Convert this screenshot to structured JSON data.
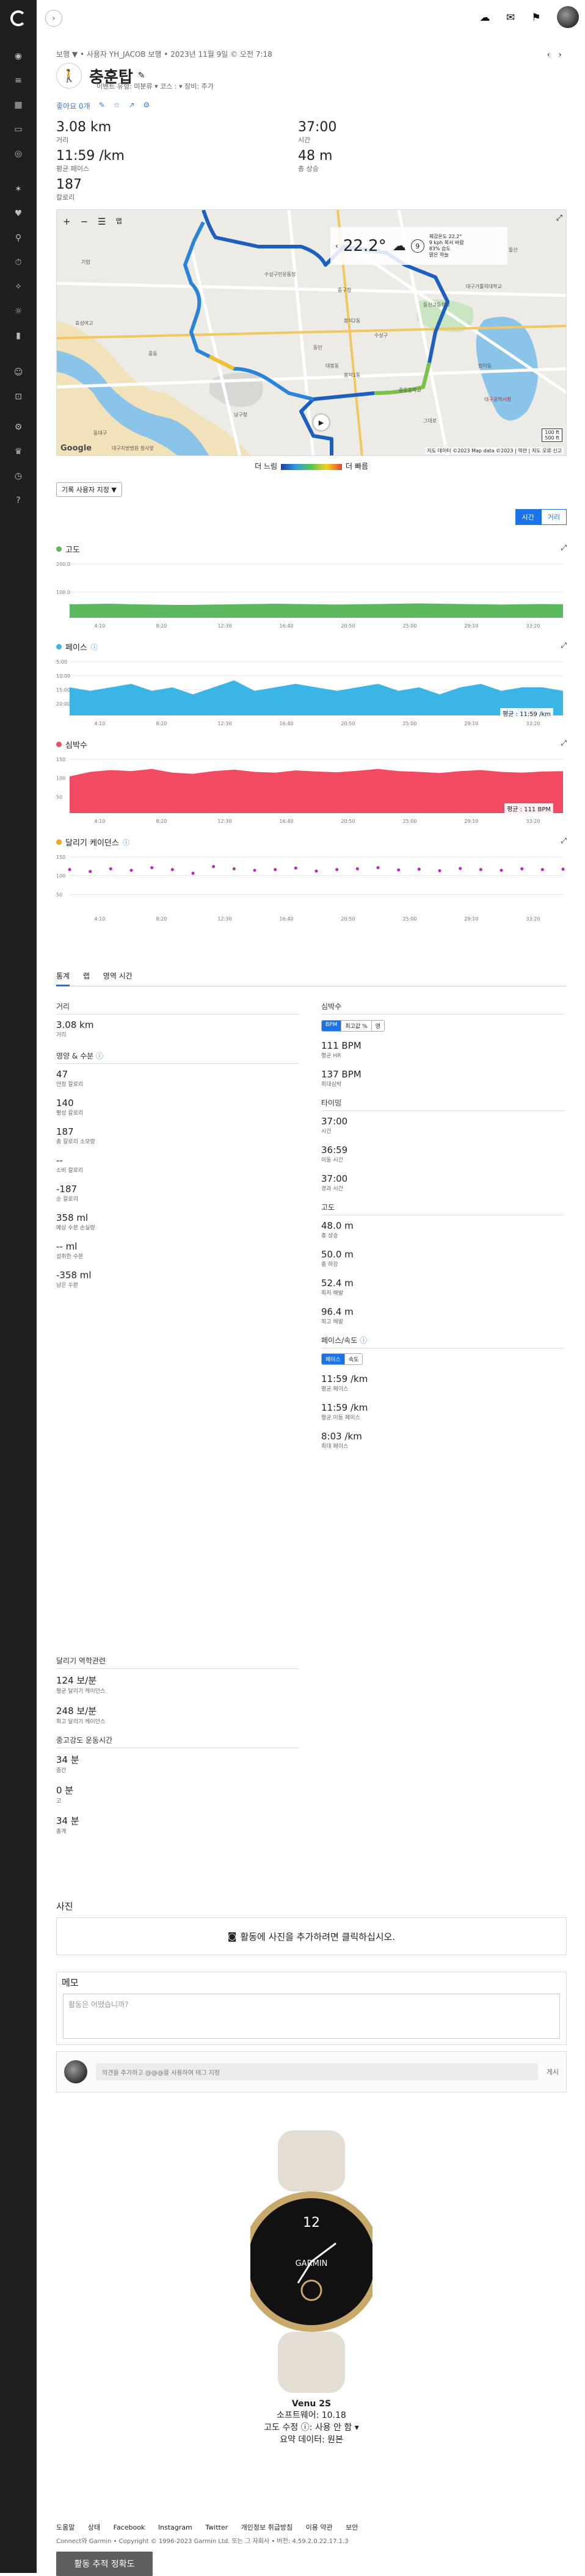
{
  "app": {
    "title": "Garmin Connect"
  },
  "sidebar": {
    "items": [
      "dashboard",
      "calendar",
      "training",
      "reports",
      "running",
      "health",
      "performance",
      "settings",
      "devices",
      "badges",
      "challenges",
      "groups",
      "connections",
      "insights"
    ]
  },
  "header": {
    "icons": [
      "upload-icon",
      "inbox-icon",
      "notifications-icon"
    ]
  },
  "activity": {
    "breadcrumb": "보행 ▼ • 사용자 YH_JACOB 보행 • 2023년 11월 9일 © 오전 7:18",
    "title": "충훈탑",
    "subtitle": "이벤트 유형: 미분류 ▾    코스 : ▾    장비: 추가",
    "actions": [
      "좋아요 0개",
      "✎",
      "☆",
      "↗",
      "⚙"
    ],
    "stats": [
      {
        "value": "3.08 km",
        "label": "거리"
      },
      {
        "value": "37:00",
        "label": "시간"
      },
      {
        "value": "11:59 /km",
        "label": "평균 페이스"
      },
      {
        "value": "48 m",
        "label": "총 상승"
      },
      {
        "value": "187",
        "label": "칼로리"
      }
    ]
  },
  "map": {
    "weather_temp": "22.2°",
    "weather_detail": "체감온도 22.2°\n9 kph 북서 바람\n83% 습도\n맑은 하늘",
    "wind_badge": "9",
    "labels": [
      "기업",
      "중구청",
      "봉덕2동",
      "동민",
      "봉덕1동",
      "동신고등학교",
      "대구가톨릭대학교",
      "효성여고",
      "수성구민운동장",
      "중동중학교",
      "대구광역시청",
      "대구지방법원 청사앞",
      "동대구",
      "남구청",
      "대봉동",
      "범어동",
      "중동",
      "수성구",
      "그대로",
      "돌산"
    ],
    "scale": [
      "100 ft",
      "500 ft"
    ],
    "attribution": "지도 데이터 ©2023 Map data ©2023 | 약관 | 지도 오류 신고",
    "legend_left": "더 느림",
    "legend_right": "더 빠름",
    "controls": [
      "+",
      "−",
      "레이어",
      "맵"
    ]
  },
  "chart_controls": {
    "dropdown": "기록 사용자 지정 ▼",
    "toggle": [
      "시간",
      "거리"
    ]
  },
  "charts": {
    "elevation": {
      "label": "고도",
      "color": "#5cb85c"
    },
    "pace": {
      "label": "페이스",
      "color": "#3ab5e6",
      "avg_label": "평균 : 11:59 /km"
    },
    "heart": {
      "label": "심박수",
      "color": "#f24a63",
      "avg_label": "평균 : 111 BPM"
    },
    "cadence": {
      "label": "달리기 케이던스",
      "color": "#c023c2"
    }
  },
  "chart_data": [
    {
      "type": "area",
      "title": "고도",
      "series": [
        {
          "values": [
            48,
            49,
            50,
            48,
            47,
            46,
            46,
            47,
            48,
            49,
            50,
            49,
            48,
            47,
            48,
            49,
            50,
            51,
            50,
            49,
            48,
            47,
            48,
            49,
            48
          ]
        }
      ],
      "x": [
        "4:10",
        "8:20",
        "12:30",
        "16:40",
        "20:50",
        "25:00",
        "29:10",
        "33:20"
      ],
      "ylim": [
        0,
        200
      ],
      "yticks": [
        "200.0",
        "100.0"
      ]
    },
    {
      "type": "area",
      "title": "페이스",
      "series": [
        {
          "values": [
            12,
            11,
            12,
            13,
            11,
            12,
            10,
            12,
            14,
            11,
            12,
            13,
            12,
            11,
            12,
            13,
            11,
            12,
            10,
            12,
            13,
            11,
            12,
            12,
            11
          ]
        }
      ],
      "x": [
        "4:10",
        "8:20",
        "12:30",
        "16:40",
        "20:50",
        "25:00",
        "29:10",
        "33:20"
      ],
      "yticks": [
        "5:00",
        "10:00",
        "15:00",
        "20:00"
      ]
    },
    {
      "type": "area",
      "title": "심박수",
      "series": [
        {
          "values": [
            98,
            110,
            115,
            112,
            118,
            108,
            105,
            112,
            116,
            110,
            108,
            114,
            111,
            109,
            113,
            118,
            112,
            110,
            107,
            112,
            115,
            110,
            108,
            111,
            112
          ]
        }
      ],
      "x": [
        "4:10",
        "8:20",
        "12:30",
        "16:40",
        "20:50",
        "25:00",
        "29:10",
        "33:20"
      ],
      "yticks": [
        "150",
        "100",
        "50"
      ],
      "ylim": [
        0,
        150
      ]
    },
    {
      "type": "scatter",
      "title": "달리기 케이던스",
      "series": [
        {
          "values": [
            110,
            105,
            112,
            108,
            115,
            110,
            100,
            118,
            112,
            108,
            110,
            114,
            106,
            110,
            112,
            115,
            109,
            111,
            107,
            113,
            110,
            108,
            112,
            110,
            111
          ]
        }
      ],
      "x": [
        "4:10",
        "8:20",
        "12:30",
        "16:40",
        "20:50",
        "25:00",
        "29:10",
        "33:20"
      ],
      "yticks": [
        "150",
        "100",
        "50"
      ],
      "ylim": [
        0,
        150
      ]
    }
  ],
  "tabs": [
    "통계",
    "랩",
    "영역 시간"
  ],
  "left_stats": {
    "distance_title": "거리",
    "distance": {
      "value": "3.08 km",
      "label": "거리"
    },
    "nutrition_title": "영양 & 수분",
    "nutrition": [
      {
        "value": "47",
        "label": "안정 칼로리"
      },
      {
        "value": "140",
        "label": "활성 칼로리"
      },
      {
        "value": "187",
        "label": "총 칼로리 소모량"
      },
      {
        "value": "--",
        "label": "소비 칼로리"
      },
      {
        "value": "-187",
        "label": "순 칼로리"
      },
      {
        "value": "358 ml",
        "label": "예상 수분 손실량"
      },
      {
        "value": "-- ml",
        "label": "섭취한 수분"
      },
      {
        "value": "-358 ml",
        "label": "남은 수분"
      }
    ],
    "dynamics_title": "달리기 역학관련",
    "dynamics": [
      {
        "value": "124 보/분",
        "label": "평균 달리기 케이던스"
      },
      {
        "value": "248 보/분",
        "label": "최고 달리기 케이던스"
      }
    ],
    "intensity_title": "중고강도 운동시간",
    "intensity": [
      {
        "value": "34 분",
        "label": "중간"
      },
      {
        "value": "0 분",
        "label": "고"
      },
      {
        "value": "34 분",
        "label": "총계"
      }
    ]
  },
  "right_stats": {
    "hr_title": "심박수",
    "hr_toggle": [
      "BPM",
      "최고값 %",
      "영"
    ],
    "hr": [
      {
        "value": "111 BPM",
        "label": "평균 HR"
      },
      {
        "value": "137 BPM",
        "label": "최대심박"
      }
    ],
    "time_title": "타이밍",
    "time": [
      {
        "value": "37:00",
        "label": "시간"
      },
      {
        "value": "36:59",
        "label": "이동 시간"
      },
      {
        "value": "37:00",
        "label": "경과 시간"
      }
    ],
    "elev_title": "고도",
    "elev": [
      {
        "value": "48.0 m",
        "label": "총 상승"
      },
      {
        "value": "50.0 m",
        "label": "총 하강"
      },
      {
        "value": "52.4 m",
        "label": "최저 해발"
      },
      {
        "value": "96.4 m",
        "label": "최고 해발"
      }
    ],
    "pace_title": "페이스/속도",
    "pace_toggle": [
      "페이스",
      "속도"
    ],
    "pace": [
      {
        "value": "11:59 /km",
        "label": "평균 페이스"
      },
      {
        "value": "11:59 /km",
        "label": "평균 이동 페이스"
      },
      {
        "value": "8:03 /km",
        "label": "최대 페이스"
      }
    ]
  },
  "photos": {
    "title": "사진",
    "prompt": "활동에 사진을 추가하려면 클릭하십시오."
  },
  "memo": {
    "title": "메모",
    "placeholder": "활동은 어땠습니까?"
  },
  "comment": {
    "placeholder": "의견을 추가하고 @@@을 사용하여 태그 지정",
    "post": "게시"
  },
  "device": {
    "watch_time": "12",
    "name": "Venu 2S",
    "software": "소프트웨어: 10.18",
    "elev_corr": "고도 수정 ⓘ: 사용 안 함 ▾",
    "source": "요약 데이터: 원본"
  },
  "footer": {
    "links": [
      "도움말",
      "상태",
      "Facebook",
      "Instagram",
      "Twitter",
      "개인정보 취급방침",
      "이용 약관",
      "보안"
    ],
    "copyright": "Connect와 Garmin • Copyright © 1996-2023 Garmin Ltd. 또는 그 자회사 • 버전: 4.59.2.0.22.17.1.3"
  },
  "feedback_button": "활동 추적 정확도"
}
